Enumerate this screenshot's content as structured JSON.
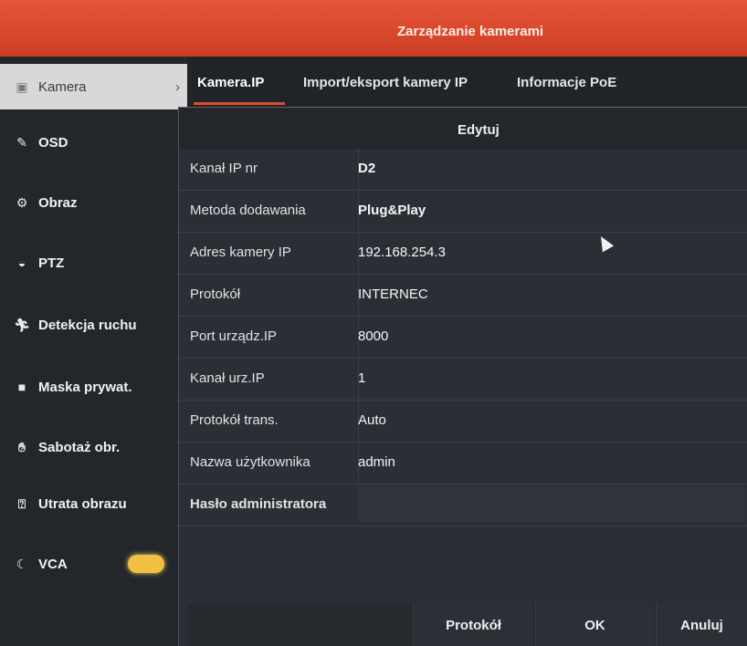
{
  "window": {
    "title": "Zarządzanie kamerami"
  },
  "sidebar": {
    "items": [
      {
        "label": "Kamera",
        "icon": "camera-icon",
        "active": true
      },
      {
        "label": "OSD",
        "icon": "osd-icon"
      },
      {
        "label": "Obraz",
        "icon": "image-icon"
      },
      {
        "label": "PTZ",
        "icon": "ptz-icon"
      },
      {
        "label": "Detekcja ruchu",
        "icon": "motion-icon"
      },
      {
        "label": "Maska prywat.",
        "icon": "privacy-mask-icon"
      },
      {
        "label": "Sabotaż obr.",
        "icon": "tamper-icon"
      },
      {
        "label": "Utrata obrazu",
        "icon": "video-loss-icon"
      },
      {
        "label": "VCA",
        "icon": "vca-icon"
      }
    ]
  },
  "tabs": [
    {
      "label": "Kamera.IP",
      "active": true
    },
    {
      "label": "Import/eksport kamery IP"
    },
    {
      "label": "Informacje PoE"
    }
  ],
  "dialog": {
    "title": "Edytuj",
    "rows": [
      {
        "label": "Kanał IP nr",
        "value": "D2"
      },
      {
        "label": "Metoda dodawania",
        "value": "Plug&Play"
      },
      {
        "label": "Adres kamery IP",
        "value": "192.168.254.3"
      },
      {
        "label": "Protokół",
        "value": "INTERNEC"
      },
      {
        "label": "Port urządz.IP",
        "value": "8000"
      },
      {
        "label": "Kanał urz.IP",
        "value": "1"
      },
      {
        "label": "Protokół trans.",
        "value": "Auto"
      },
      {
        "label": "Nazwa użytkownika",
        "value": "admin"
      },
      {
        "label": "Hasło administratora",
        "value": ""
      }
    ]
  },
  "footer": {
    "protocol_label": "Protokół",
    "ok_label": "OK",
    "cancel_label": "Anuluj"
  },
  "colors": {
    "accent": "#d9472b",
    "toggle": "#f0c040"
  }
}
